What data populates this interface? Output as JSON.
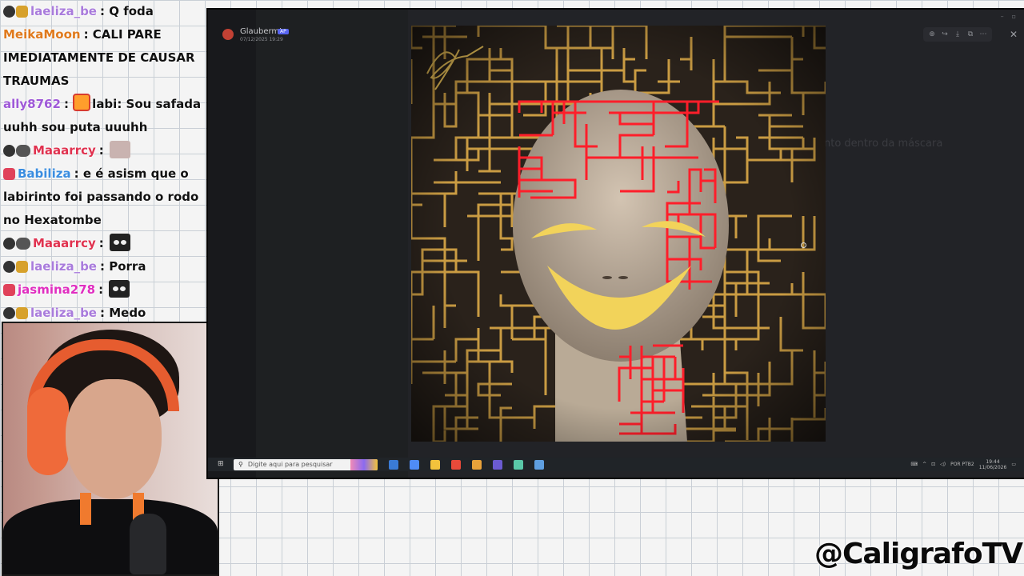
{
  "chat": {
    "messages": [
      {
        "user": "laeliza_be",
        "user_color": "#a97bdc",
        "text": "Q foda",
        "icons": [
          "moon",
          "smile"
        ]
      },
      {
        "user": "MeikaMoon",
        "user_color": "#e07a1d",
        "text": "CALI PARE IMEDIATAMENTE DE CAUSAR TRAUMAS",
        "icons": []
      },
      {
        "user": "ally8762",
        "user_color": "#9f59d8",
        "text": "labi: Sou safada uuhh sou puta uuuhh",
        "icons": [],
        "inline_icon": true
      },
      {
        "user": "Maaarrcy",
        "user_color": "#e0324f",
        "text": "",
        "icons": [
          "moon",
          "tag"
        ],
        "emote": "light"
      },
      {
        "user": "Babiliza",
        "user_color": "#3a8de0",
        "text": "e é asism que o labirinto foi passando o rodo no Hexatombe",
        "icons": [
          "heart"
        ]
      },
      {
        "user": "Maaarrcy",
        "user_color": "#e0324f",
        "text": "",
        "icons": [
          "moon",
          "tag"
        ],
        "emote": "eye"
      },
      {
        "user": "laeliza_be",
        "user_color": "#a97bdc",
        "text": "Porra",
        "icons": [
          "moon",
          "smile"
        ]
      },
      {
        "user": "jasmina278",
        "user_color": "#e02ec0",
        "text": "",
        "icons": [
          "heart"
        ],
        "emote": "eye"
      },
      {
        "user": "laeliza_be",
        "user_color": "#a97bdc",
        "text": "Medo",
        "icons": [
          "moon",
          "smile"
        ]
      }
    ]
  },
  "viewer": {
    "poster_name": "Glaubermts",
    "poster_badge": "AP",
    "poster_date": "07/12/2025 19:29",
    "window_title": "",
    "side_text": "nto dentro da máscara"
  },
  "taskbar": {
    "search_placeholder": "Digite aqui para pesquisar",
    "tray_lang": "POR PTB2",
    "clock_time": "19:44",
    "clock_date": "11/06/2026",
    "app_colors": [
      "#3a7bd5",
      "#4f8cf7",
      "#f2c23c",
      "#e84a3a",
      "#e8a23a",
      "#6b5bd2",
      "#5ac8a8",
      "#5f9fe0"
    ]
  },
  "watermark": "@CaligrafoTV",
  "colors": {
    "maze_gold": "#e6b24a",
    "maze_red": "#ff1e2a",
    "mask_yellow": "#f2d35a"
  }
}
